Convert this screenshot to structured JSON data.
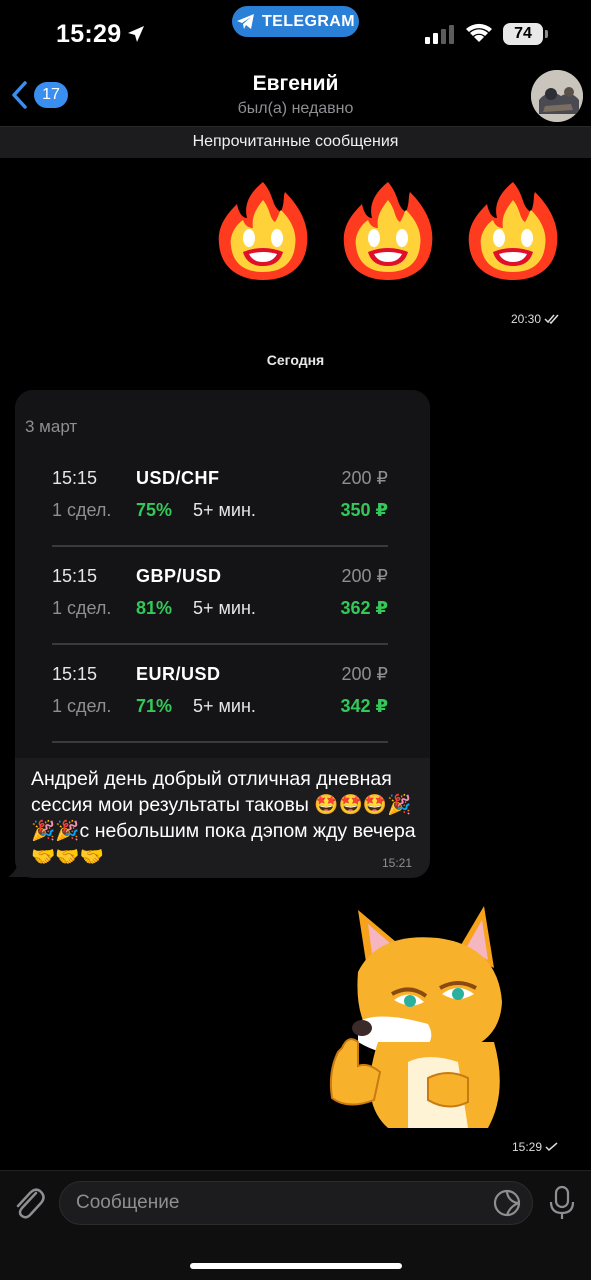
{
  "status_bar": {
    "time": "15:29",
    "app_pill": "TELEGRAM",
    "battery": "74",
    "icons": [
      "location-arrow-icon",
      "telegram-icon",
      "signal-icon",
      "wifi-icon",
      "battery-icon"
    ]
  },
  "header": {
    "back_count": "17",
    "name": "Евгений",
    "status": "был(а) недавно"
  },
  "unread_label": "Непрочитанные сообщения",
  "outgoing_fire": {
    "emoji_count": 3,
    "time": "20:30",
    "read": true
  },
  "date_separator": "Сегодня",
  "incoming_message": {
    "photo": {
      "date": "3 март",
      "trades": [
        {
          "time": "15:15",
          "pair": "USD/CHF",
          "amount": "200 ₽",
          "deals": "1 сдел.",
          "percent": "75%",
          "duration": "5+ мин.",
          "payout": "350 ₽"
        },
        {
          "time": "15:15",
          "pair": "GBP/USD",
          "amount": "200 ₽",
          "deals": "1 сдел.",
          "percent": "81%",
          "duration": "5+ мин.",
          "payout": "362 ₽"
        },
        {
          "time": "15:15",
          "pair": "EUR/USD",
          "amount": "200 ₽",
          "deals": "1 сдел.",
          "percent": "71%",
          "duration": "5+ мин.",
          "payout": "342 ₽"
        }
      ]
    },
    "text": "Андрей день добрый отличная дневная сессия мои результаты таковы 🤩🤩🤩🎉🎉🎉с небольшим пока дэпом жду вечера 🤝🤝🤝",
    "time": "15:21"
  },
  "outgoing_sticker": {
    "sticker": "fox-thumbs-up",
    "time": "15:29",
    "read": false
  },
  "input": {
    "placeholder": "Сообщение"
  },
  "colors": {
    "accent": "#3a8ef0",
    "pill": "#2a7fd6",
    "green": "#34c759",
    "bubble": "#1c1c1e",
    "background": "#000000"
  }
}
